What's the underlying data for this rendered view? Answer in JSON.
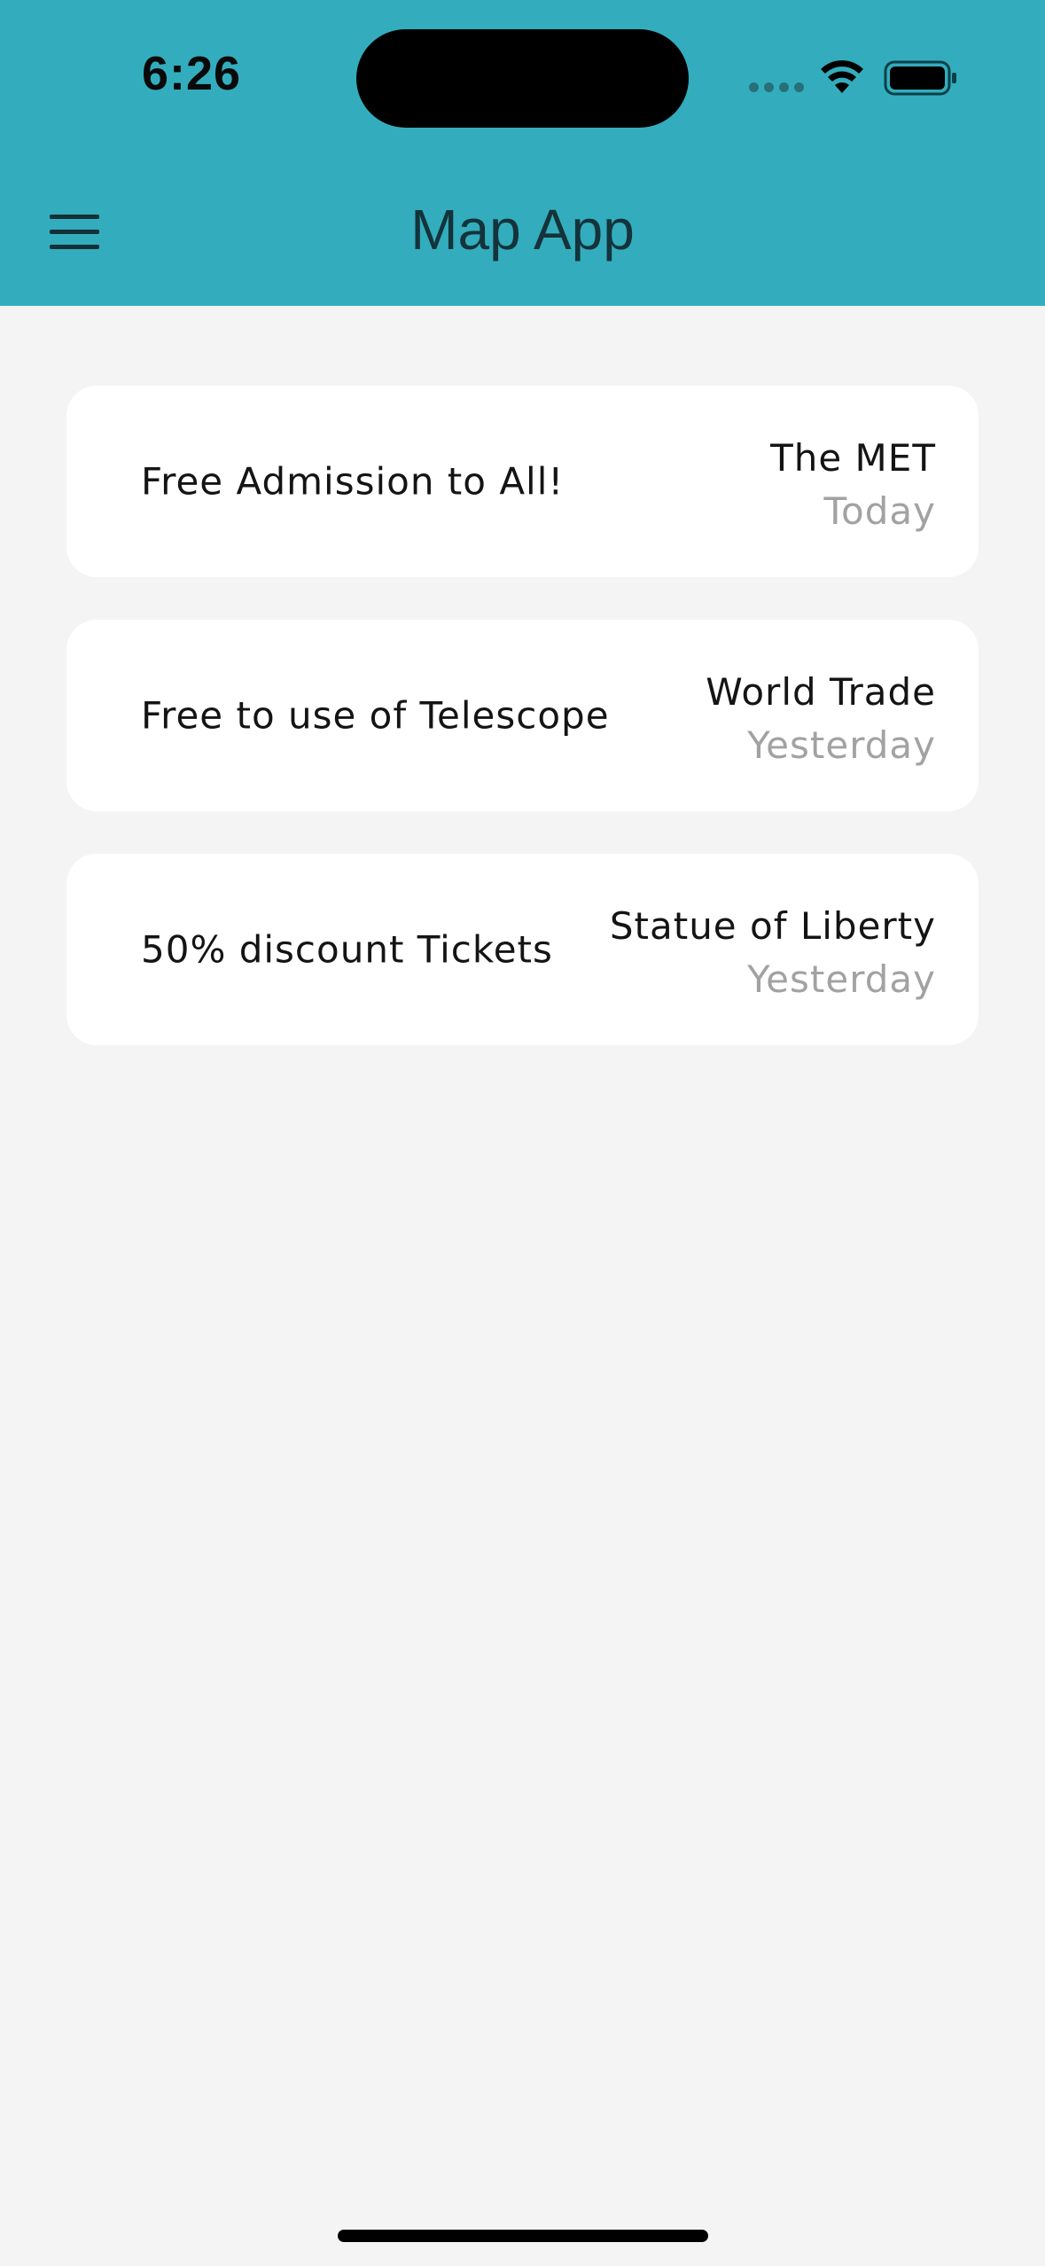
{
  "status_bar": {
    "time": "6:26"
  },
  "header": {
    "title": "Map App",
    "color": "#33adbd",
    "menu_icon": "hamburger-menu-icon"
  },
  "offers": [
    {
      "title": "Free Admission to All!",
      "place": "The MET",
      "time": "Today"
    },
    {
      "title": "Free to use of Telescope",
      "place": "World Trade",
      "time": "Yesterday"
    },
    {
      "title": "50% discount Tickets",
      "place": "Statue of Liberty",
      "time": "Yesterday"
    }
  ]
}
